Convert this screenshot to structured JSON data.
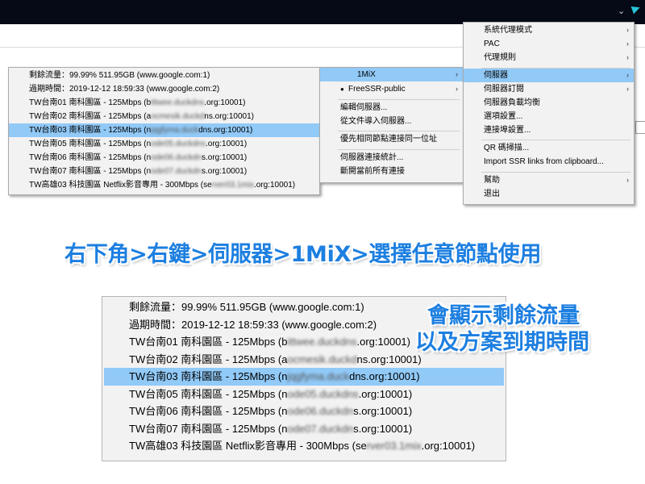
{
  "server_list": [
    {
      "pre": "剩餘流量：99.99% 511.95GB (www.google.com:1)",
      "blur": "",
      "post": ""
    },
    {
      "pre": "過期時間：2019-12-12 18:59:33 (www.google.com:2)",
      "blur": "",
      "post": ""
    },
    {
      "pre": "TW台南01 南科園區 - 125Mbps (b",
      "blur": "ittwee.duckdns",
      "post": ".org:10001)"
    },
    {
      "pre": "TW台南02 南科園區 - 125Mbps (a",
      "blur": "ocmesik.duckd",
      "post": "ns.org:10001)"
    },
    {
      "pre": "TW台南03 南科園區 - 125Mbps (n",
      "blur": "jqgfyma.duck",
      "post": "dns.org:10001)"
    },
    {
      "pre": "TW台南05 南科園區 - 125Mbps (n",
      "blur": "ode05.duckdns",
      "post": ".org:10001)"
    },
    {
      "pre": "TW台南06 南科園區 - 125Mbps (n",
      "blur": "ode06.duckdn",
      "post": "s.org:10001)"
    },
    {
      "pre": "TW台南07 南科園區 - 125Mbps (n",
      "blur": "ode07.duckdn",
      "post": "s.org:10001)"
    },
    {
      "pre": "TW高雄03 科技園區 Netflix影音專用 - 300Mbps (se",
      "blur": "rver03.1mix",
      "post": ".org:10001)"
    }
  ],
  "server_list_selected_index": 4,
  "group_menu": {
    "items": [
      "1MiX",
      "FreeSSR-public"
    ],
    "bullet": "●",
    "actions_a": [
      "編輯伺服器...",
      "從文件導入伺服器..."
    ],
    "actions_b": [
      "優先相同節點連接同一位址"
    ],
    "actions_c": [
      "伺服器連接統計...",
      "斷開當前所有連接"
    ]
  },
  "main_menu": {
    "top": [
      "系統代理模式",
      "PAC",
      "代理規則"
    ],
    "mid": [
      "伺服器",
      "伺服器訂閱",
      "伺服器負載均衡",
      "選項設置...",
      "連接埠設置..."
    ],
    "qr": [
      "QR 碼掃描...",
      "Import SSR links from clipboard..."
    ],
    "bottom": [
      "幫助",
      "退出"
    ]
  },
  "submenu_arrow": "›",
  "tray": {
    "chevron": "⌄"
  },
  "captions": {
    "main": "右下角>右鍵>伺服器>1MiX>選擇任意節點使用",
    "side_line1": "會顯示剩餘流量",
    "side_line2": "以及方案到期時間"
  },
  "colors": {
    "highlight": "#91c9f7",
    "caption": "#1d7fe0",
    "taskbar": "#050a16"
  }
}
